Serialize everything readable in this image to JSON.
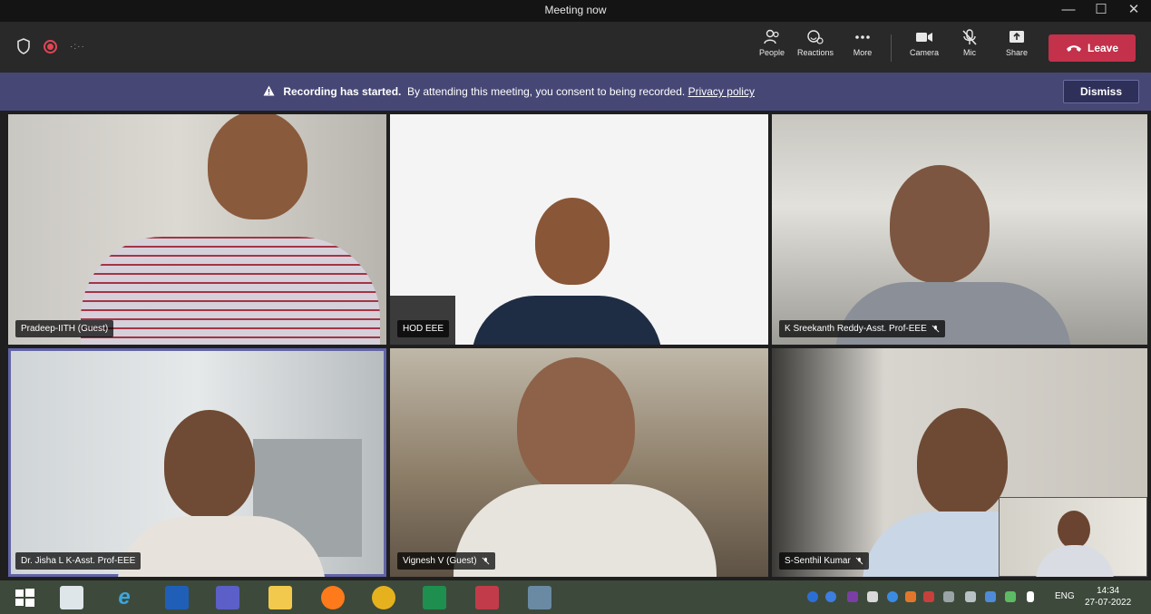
{
  "window": {
    "title": "Meeting now",
    "minimize": "—",
    "maximize": "☐",
    "close": "✕"
  },
  "toolbar": {
    "timer": "·:··",
    "people": "People",
    "reactions": "Reactions",
    "more": "More",
    "camera": "Camera",
    "mic": "Mic",
    "share": "Share",
    "leave": "Leave"
  },
  "banner": {
    "strong": "Recording has started.",
    "text": "By attending this meeting, you consent to being recorded.",
    "link": "Privacy policy",
    "dismiss": "Dismiss"
  },
  "participants": [
    {
      "name": "Pradeep-IITH (Guest)",
      "muted": false
    },
    {
      "name": "HOD EEE",
      "muted": false
    },
    {
      "name": "K Sreekanth Reddy-Asst. Prof-EEE",
      "muted": true
    },
    {
      "name": "Dr. Jisha L K-Asst. Prof-EEE",
      "muted": false
    },
    {
      "name": "Vignesh V (Guest)",
      "muted": true
    },
    {
      "name": "S-Senthil Kumar",
      "muted": true
    }
  ],
  "taskbar": {
    "language": "ENG",
    "time": "14:34",
    "date": "27-07-2022"
  },
  "colors": {
    "leave": "#c4314b",
    "banner": "#464775",
    "active_border": "#6264a7"
  }
}
